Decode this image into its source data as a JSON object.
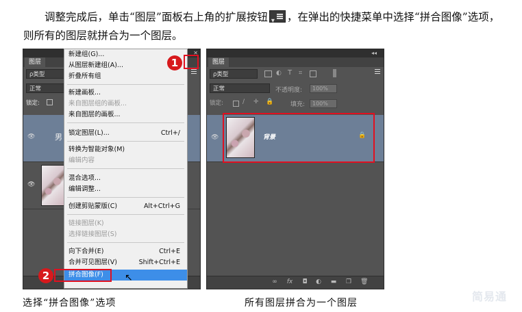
{
  "paragraph": {
    "part1": "调整完成后，单击“图层”面板右上角的扩展按钮",
    "part2": "，在弹出的快捷菜单中选择“拼合图像”选项，则所有的图层就拼合为一个图层。"
  },
  "left_panel": {
    "tab": "图层",
    "filter": "ρ类型",
    "blend": "正常",
    "lock": "锁定:",
    "layer1_name": "男"
  },
  "context_menu": {
    "items": [
      {
        "label": "新建组(G)...",
        "shortcut": "",
        "disabled": false
      },
      {
        "label": "从图层新建组(A)...",
        "shortcut": "",
        "disabled": false
      },
      {
        "label": "折叠所有组",
        "shortcut": "",
        "disabled": false
      },
      {
        "label": "新建画板...",
        "shortcut": "",
        "disabled": false
      },
      {
        "label": "来自图层组的画板...",
        "shortcut": "",
        "disabled": true
      },
      {
        "label": "来自图层的画板...",
        "shortcut": "",
        "disabled": false
      },
      {
        "label": "锁定图层(L)...",
        "shortcut": "Ctrl+/",
        "disabled": false
      },
      {
        "label": "转换为智能对象(M)",
        "shortcut": "",
        "disabled": false
      },
      {
        "label": "编辑内容",
        "shortcut": "",
        "disabled": true
      },
      {
        "label": "混合选项...",
        "shortcut": "",
        "disabled": false
      },
      {
        "label": "编辑调整...",
        "shortcut": "",
        "disabled": false
      },
      {
        "label": "创建剪贴蒙版(C)",
        "shortcut": "Alt+Ctrl+G",
        "disabled": false
      },
      {
        "label": "链接图层(K)",
        "shortcut": "",
        "disabled": true
      },
      {
        "label": "选择链接图层(S)",
        "shortcut": "",
        "disabled": true
      },
      {
        "label": "向下合并(E)",
        "shortcut": "Ctrl+E",
        "disabled": false
      },
      {
        "label": "合并可见图层(V)",
        "shortcut": "Shift+Ctrl+E",
        "disabled": false
      },
      {
        "label": "拼合图像(F)",
        "shortcut": "",
        "disabled": false
      }
    ]
  },
  "right_panel": {
    "tab": "图层",
    "filter": "ρ类型",
    "blend": "正常",
    "opacity_label": "不透明度:",
    "opacity_value": "100%",
    "lock": "锁定:",
    "fill_label": "填充:",
    "fill_value": "100%",
    "layer_name": "背景"
  },
  "badges": {
    "one": "1",
    "two": "2"
  },
  "captions": {
    "left": "选择“拼合图像”选项",
    "right": "所有图层拼合为一个图层"
  },
  "watermark": "简易通"
}
